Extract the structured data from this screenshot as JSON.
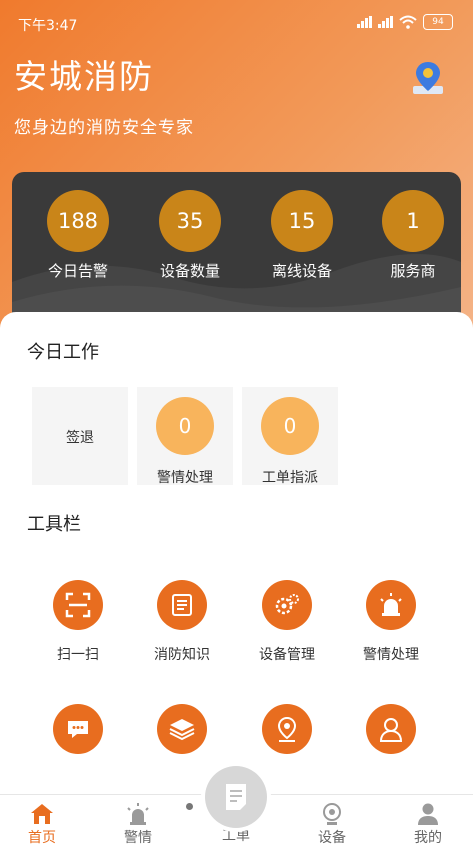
{
  "status_bar": {
    "time": "下午3:47",
    "battery": "94"
  },
  "header": {
    "title": "安城消防",
    "subtitle": "您身边的消防安全专家"
  },
  "stats": [
    {
      "value": "188",
      "label": "今日告警"
    },
    {
      "value": "35",
      "label": "设备数量"
    },
    {
      "value": "15",
      "label": "离线设备"
    },
    {
      "value": "1",
      "label": "服务商"
    }
  ],
  "today_work": {
    "title": "今日工作",
    "items": [
      {
        "label": "签退"
      },
      {
        "value": "0",
        "label": "警情处理"
      },
      {
        "value": "0",
        "label": "工单指派"
      }
    ]
  },
  "toolbar": {
    "title": "工具栏",
    "items": [
      {
        "label": "扫一扫",
        "icon": "scan-icon"
      },
      {
        "label": "消防知识",
        "icon": "document-icon"
      },
      {
        "label": "设备管理",
        "icon": "gears-icon"
      },
      {
        "label": "警情处理",
        "icon": "alarm-light-icon"
      },
      {
        "icon": "message-icon"
      },
      {
        "icon": "layers-icon"
      },
      {
        "icon": "location-icon"
      },
      {
        "icon": "user-icon"
      }
    ]
  },
  "bottom_nav": [
    {
      "label": "首页",
      "icon": "home-icon",
      "active": true
    },
    {
      "label": "警情",
      "icon": "alarm-icon"
    },
    {
      "label": "工单",
      "icon": "workorder-icon"
    },
    {
      "label": "设备",
      "icon": "camera-icon"
    },
    {
      "label": "我的",
      "icon": "person-icon"
    }
  ],
  "colors": {
    "accent": "#e86d1f",
    "stat_circle": "#c98519",
    "work_circle": "#f8b45c",
    "card_dark": "#3a3a3a"
  }
}
